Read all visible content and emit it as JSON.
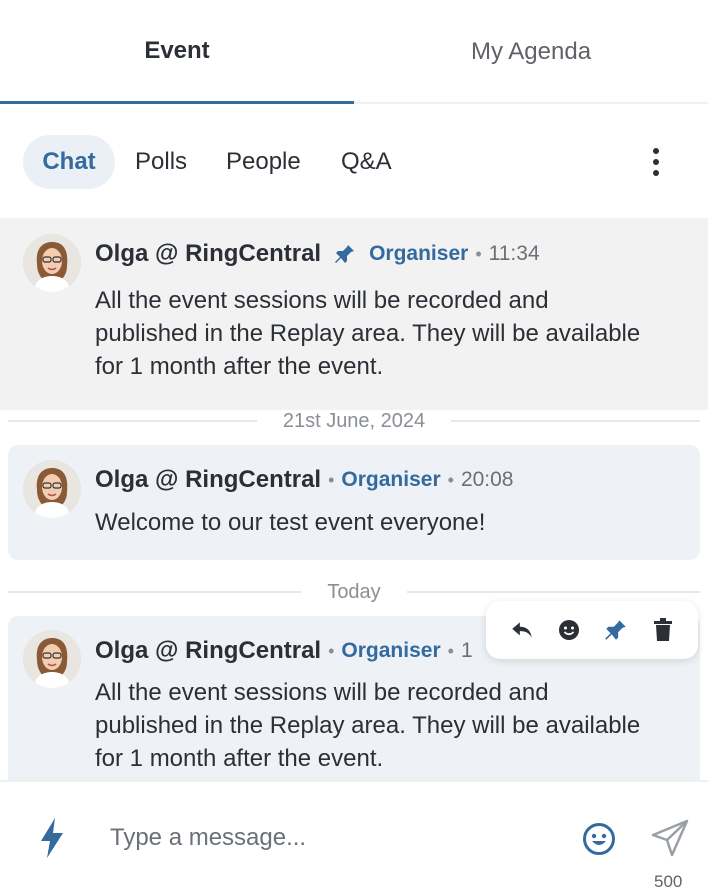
{
  "top_tabs": [
    {
      "label": "Event",
      "active": true
    },
    {
      "label": "My Agenda",
      "active": false
    }
  ],
  "sub_tabs": [
    {
      "label": "Chat",
      "active": true
    },
    {
      "label": "Polls",
      "active": false
    },
    {
      "label": "People",
      "active": false
    },
    {
      "label": "Q&A",
      "active": false
    }
  ],
  "messages": [
    {
      "author": "Olga @ RingCentral",
      "role": "Organiser",
      "time": "11:34",
      "pinned": true,
      "text": "All the event sessions will be recorded and published in the Replay area. They will be available for 1 month after the event."
    },
    {
      "author": "Olga @ RingCentral",
      "role": "Organiser",
      "time": "20:08",
      "pinned": false,
      "text": "Welcome to our test event everyone!"
    },
    {
      "author": "Olga @ RingCentral",
      "role": "Organiser",
      "time": "1",
      "pinned": false,
      "text": "All the event sessions will be recorded and published in the Replay area. They will be available for 1 month after the event."
    }
  ],
  "date_separators": [
    "21st June, 2024",
    "Today"
  ],
  "message_actions": [
    "reply-icon",
    "emoji-react-icon",
    "pin-icon",
    "delete-icon"
  ],
  "composer": {
    "placeholder": "Type a message...",
    "char_limit": "500"
  },
  "colors": {
    "accent": "#346a9e",
    "pinned_bg": "#f2f2f2",
    "card_bg": "#eef2f6",
    "active_tab_bg": "#eaf0f6"
  }
}
